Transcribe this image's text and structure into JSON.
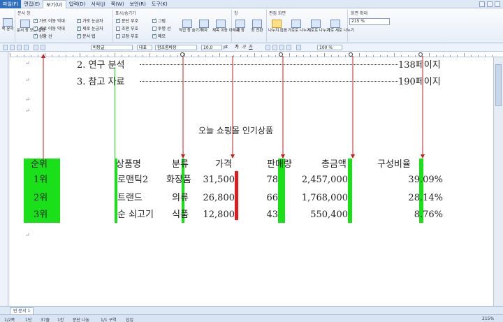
{
  "menu": {
    "items": [
      "파일(F)",
      "편집(E)",
      "보기(U)",
      "입력(D)",
      "서식(J)",
      "쪽(W)",
      "보안(R)",
      "도구(K)"
    ]
  },
  "ribbon": {
    "group_doc": "문서 창",
    "group_show": "표시/숨기기",
    "group_window": "창",
    "group_edit": "편집 화면",
    "group_zoom": "화면 확대",
    "checks_a": [
      "가로 이동 막대",
      "세로 이동 막대",
      "상황 선"
    ],
    "checks_b": [
      "가로 눈금자",
      "세로 눈금자",
      "문서 탭"
    ],
    "checks_c": [
      "문단 부호",
      "조판 부호",
      "교정 부호"
    ],
    "checks_d": [
      "그림",
      "투명 선",
      "메모"
    ],
    "btn_full": "쪽 윤곽",
    "btn_docwin": "문서 창 모양 설정",
    "btn_workwin": "작업 창 숨기기",
    "btn_grid": "격자",
    "btn_move": "제목 이동 아래로",
    "btn_newwin": "새 창",
    "btn_switch": "창 전환",
    "btn_split": "나누지 않음",
    "btn_hsplit": "가로로 나누기",
    "btn_vsplit": "세로로 나누기",
    "btn_both": "가로 세로 나누기",
    "zoom_value": "215 %"
  },
  "toolbar": {
    "style": "바탕글",
    "font_kind": "대표",
    "font": "함초롬바탕",
    "size": "10.0",
    "unit": "pt",
    "ratio": "100 %"
  },
  "document": {
    "toc": [
      {
        "label": "2. 연구 분석",
        "page": "138페이지"
      },
      {
        "label": "3. 참고 자료",
        "page": "190페이지"
      }
    ],
    "title": "오늘 쇼핑몰 인기상품",
    "headers": [
      "순위",
      "상품명",
      "분류",
      "가격",
      "판매량",
      "총금액",
      "구성비율"
    ],
    "rows": [
      [
        "1위",
        "로맨틱2",
        "화장품",
        "31,500",
        "78",
        "2,457,000",
        "39.09%"
      ],
      [
        "2위",
        "트랜드",
        "의류",
        "26,800",
        "66",
        "1,768,000",
        "28.14%"
      ],
      [
        "3위",
        "순 쇠고기",
        "식품",
        "12,800",
        "43",
        "550,400",
        "8.76%"
      ]
    ]
  },
  "tabs": {
    "active": "빈 문서 1"
  },
  "status": {
    "page": "1/2쪽",
    "section": "1단",
    "line": "37줄",
    "col": "1칸",
    "break": "문단 나눔",
    "area": "1/1 구역",
    "mode": "삽입",
    "zoom": "215%"
  },
  "colors": {
    "highlight_green": "#19e019",
    "highlight_red": "#e31b1b",
    "arrow_red": "#c81e1e"
  }
}
